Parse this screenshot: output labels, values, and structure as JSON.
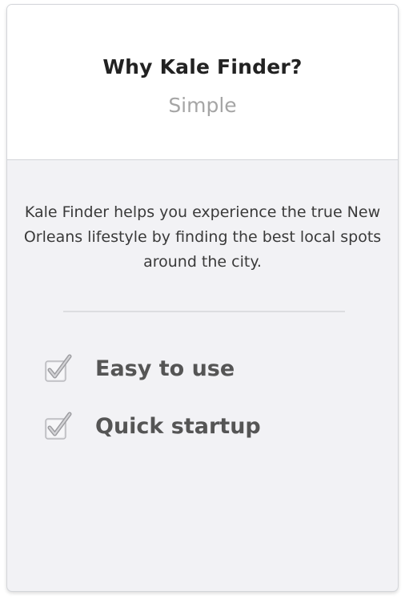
{
  "card": {
    "title": "Why Kale Finder?",
    "subtitle": "Simple",
    "description": "Kale Finder helps you experience the true New Orleans lifestyle by finding the best local spots around the city.",
    "features": [
      {
        "label": "Easy to use",
        "checked": true,
        "icon": "checkbox-checked-icon"
      },
      {
        "label": "Quick startup",
        "checked": true,
        "icon": "checkbox-checked-icon"
      }
    ]
  },
  "colors": {
    "header_bg": "#ffffff",
    "body_bg": "#f2f2f5",
    "title": "#222222",
    "subtitle": "#a5a5a5",
    "text": "#3a3a3a",
    "feature_text": "#555555"
  }
}
